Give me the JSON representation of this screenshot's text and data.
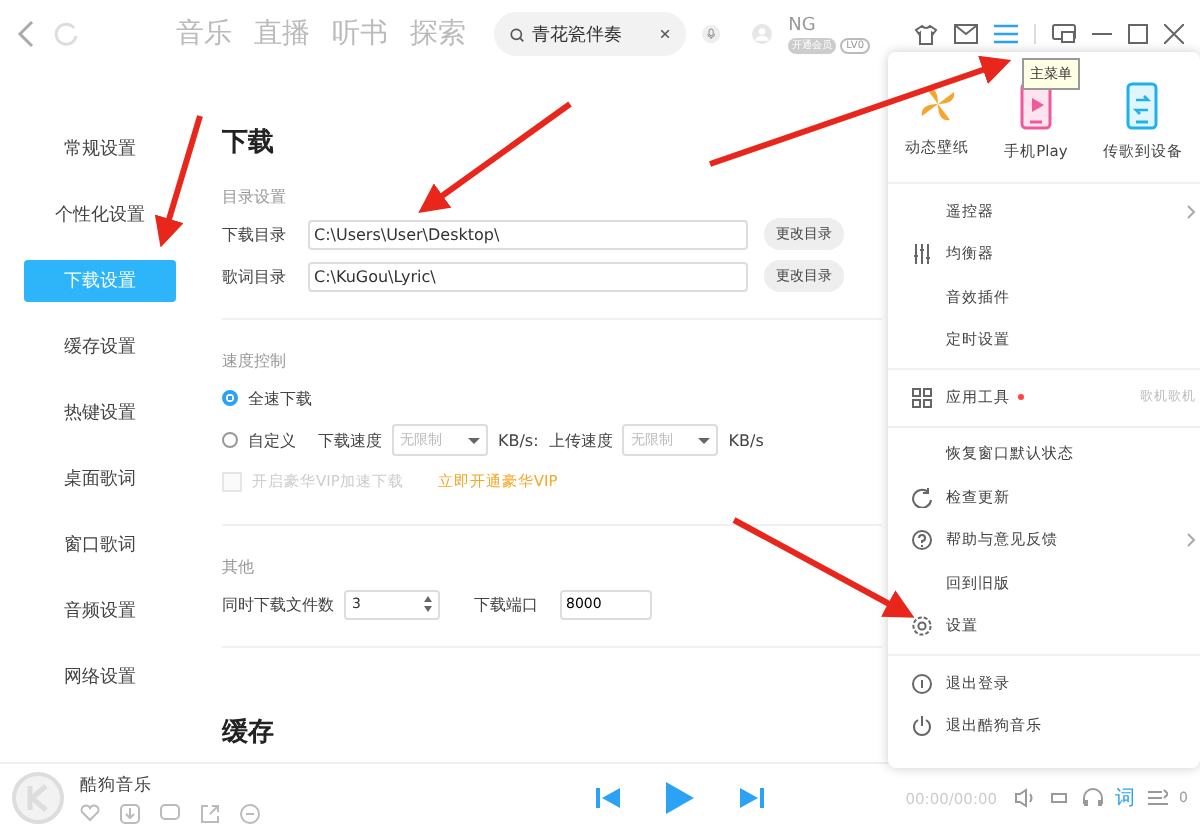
{
  "topbar": {
    "nav": [
      {
        "label": "音乐"
      },
      {
        "label": "直播"
      },
      {
        "label": "听书"
      },
      {
        "label": "探索"
      }
    ],
    "search": {
      "value": "青花瓷伴奏"
    },
    "user": {
      "name": "NG",
      "vip": "开通会员",
      "level": "LV0"
    },
    "tooltip": "主菜单"
  },
  "sidebar": {
    "items": [
      {
        "label": "常规设置",
        "selected": false
      },
      {
        "label": "个性化设置",
        "selected": false
      },
      {
        "label": "下载设置",
        "selected": true
      },
      {
        "label": "缓存设置",
        "selected": false
      },
      {
        "label": "热键设置",
        "selected": false
      },
      {
        "label": "桌面歌词",
        "selected": false
      },
      {
        "label": "窗口歌词",
        "selected": false
      },
      {
        "label": "音频设置",
        "selected": false
      },
      {
        "label": "网络设置",
        "selected": false
      }
    ]
  },
  "content": {
    "title": "下载",
    "dir": {
      "heading": "目录设置",
      "rows": [
        {
          "label": "下载目录",
          "value": "C:\\Users\\User\\Desktop\\",
          "button": "更改目录"
        },
        {
          "label": "歌词目录",
          "value": "C:\\KuGou\\Lyric\\",
          "button": "更改目录"
        }
      ]
    },
    "speed": {
      "heading": "速度控制",
      "options": [
        {
          "label": "全速下载",
          "selected": true
        },
        {
          "label": "自定义",
          "selected": false
        }
      ],
      "download_label": "下载速度",
      "download_value": "无限制",
      "unit1": "KB/s:",
      "upload_label": "上传速度",
      "upload_value": "无限制",
      "unit2": "KB/s",
      "vip_check": {
        "label": "开启豪华VIP加速下载",
        "checked": false,
        "disabled": true
      },
      "vip_link": "立即开通豪华VIP"
    },
    "other": {
      "heading": "其他",
      "count_label": "同时下载文件数",
      "count_value": "3",
      "port_label": "下载端口",
      "port_value": "8000"
    },
    "next_title": "缓存"
  },
  "menu": {
    "features": [
      {
        "kind": "pinwheel",
        "label": "动态壁纸"
      },
      {
        "kind": "phone-play",
        "label": "手机Play"
      },
      {
        "kind": "phone-transfer",
        "label": "传歌到设备"
      }
    ],
    "groups": [
      [
        {
          "label": "遥控器",
          "kind": "plain",
          "submenu": true
        },
        {
          "label": "均衡器",
          "kind": "equalizer",
          "submenu": false
        },
        {
          "label": "音效插件",
          "kind": "plain",
          "submenu": false
        },
        {
          "label": "定时设置",
          "kind": "plain",
          "submenu": false
        }
      ],
      [
        {
          "label": "应用工具",
          "kind": "grid",
          "submenu": false,
          "dot": true,
          "extra": "歌机歌机"
        }
      ],
      [
        {
          "label": "恢复窗口默认状态",
          "kind": "plain",
          "submenu": false
        },
        {
          "label": "检查更新",
          "kind": "update",
          "submenu": false
        },
        {
          "label": "帮助与意见反馈",
          "kind": "help",
          "submenu": true
        },
        {
          "label": "回到旧版",
          "kind": "plain",
          "submenu": false
        },
        {
          "label": "设置",
          "kind": "gear",
          "submenu": false
        }
      ],
      [
        {
          "label": "退出登录",
          "kind": "logout",
          "submenu": false
        },
        {
          "label": "退出酷狗音乐",
          "kind": "power",
          "submenu": false
        }
      ]
    ]
  },
  "player": {
    "title": "酷狗音乐",
    "time": "00:00/00:00",
    "lyrics": "词",
    "queue_count": "0"
  }
}
